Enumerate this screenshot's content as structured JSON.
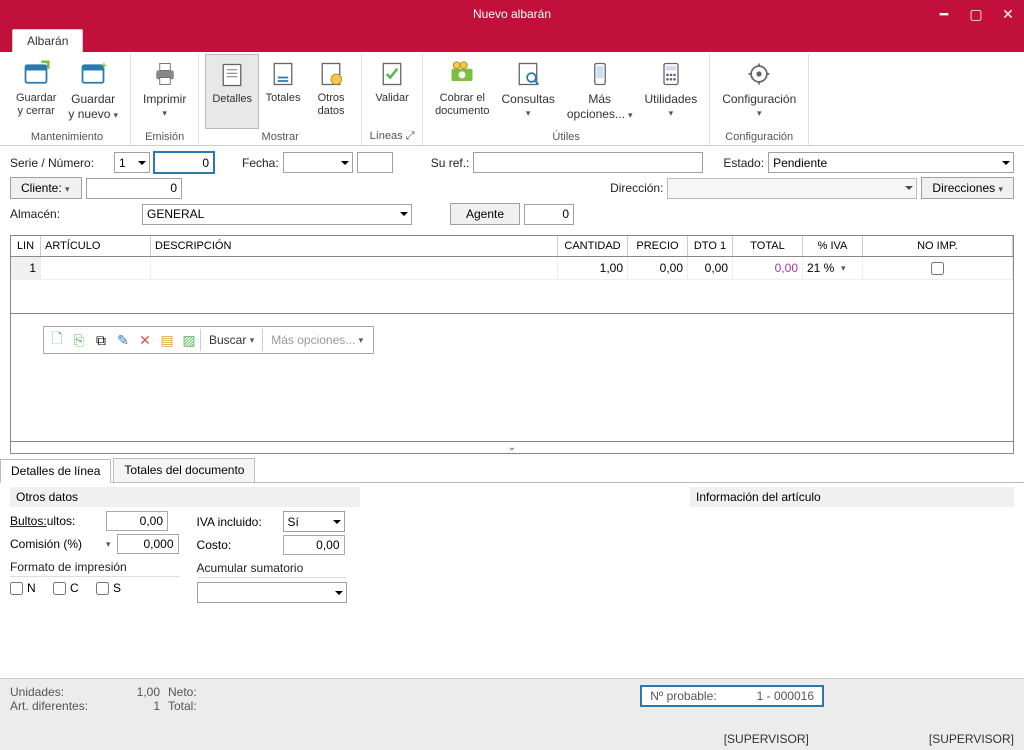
{
  "window": {
    "title": "Nuevo albarán"
  },
  "tab": {
    "name": "Albarán"
  },
  "ribbon": {
    "guardar_cerrar": "Guardar\ny cerrar",
    "guardar_nuevo": "Guardar\ny nuevo",
    "imprimir": "Imprimir",
    "detalles": "Detalles",
    "totales": "Totales",
    "otros_datos": "Otros\ndatos",
    "validar": "Validar",
    "cobrar": "Cobrar el\ndocumento",
    "consultas": "Consultas",
    "mas_opciones": "Más\nopciones...",
    "utilidades": "Utilidades",
    "configuracion": "Configuración",
    "g_mantenimiento": "Mantenimiento",
    "g_emision": "Emisión",
    "g_mostrar": "Mostrar",
    "g_lineas": "Líneas ⤢",
    "g_utiles": "Útiles",
    "g_config": "Configuración"
  },
  "form": {
    "serie_label": "Serie / Número:",
    "serie_value": "1",
    "numero_value": "0",
    "fecha_label": "Fecha:",
    "fecha_value": "",
    "suref_label": "Su ref.:",
    "suref_value": "",
    "estado_label": "Estado:",
    "estado_value": "Pendiente",
    "cliente_label": "Cliente:",
    "cliente_value": "0",
    "direccion_label": "Dirección:",
    "direcciones_btn": "Direcciones",
    "almacen_label": "Almacén:",
    "almacen_value": "GENERAL",
    "agente_btn": "Agente",
    "agente_value": "0"
  },
  "grid": {
    "headers": {
      "lin": "LIN",
      "articulo": "ARTÍCULO",
      "descripcion": "DESCRIPCIÓN",
      "cantidad": "CANTIDAD",
      "precio": "PRECIO",
      "dto1": "DTO 1",
      "total": "TOTAL",
      "iva": "% IVA",
      "noimp": "NO IMP."
    },
    "rows": [
      {
        "lin": "1",
        "articulo": "",
        "descripcion": "",
        "cantidad": "1,00",
        "precio": "0,00",
        "dto1": "0,00",
        "total": "0,00",
        "iva": "21 %",
        "noimp": false
      }
    ]
  },
  "mini_toolbar": {
    "buscar": "Buscar",
    "mas_opciones": "Más opciones..."
  },
  "bottom_tabs": {
    "detalles": "Detalles de línea",
    "totales": "Totales del documento"
  },
  "detail": {
    "otros_datos": "Otros datos",
    "info_articulo": "Información del artículo",
    "bultos_label": "Bultos:",
    "bultos_value": "0,00",
    "comision_label": "Comisión (%)",
    "comision_value": "0,000",
    "iva_incluido_label": "IVA incluido:",
    "iva_incluido_value": "Sí",
    "costo_label": "Costo:",
    "costo_value": "0,00",
    "formato_head": "Formato de impresión",
    "acumular_head": "Acumular sumatorio",
    "chk_n": "N",
    "chk_c": "C",
    "chk_s": "S"
  },
  "footer": {
    "unidades_label": "Unidades:",
    "unidades_value": "1,00",
    "neto_label": "Neto:",
    "art_dif_label": "Art. diferentes:",
    "art_dif_value": "1",
    "total_label": "Total:",
    "probable_label": "Nº probable:",
    "probable_value": "1 - 000016",
    "user1": "[SUPERVISOR]",
    "user2": "[SUPERVISOR]"
  }
}
